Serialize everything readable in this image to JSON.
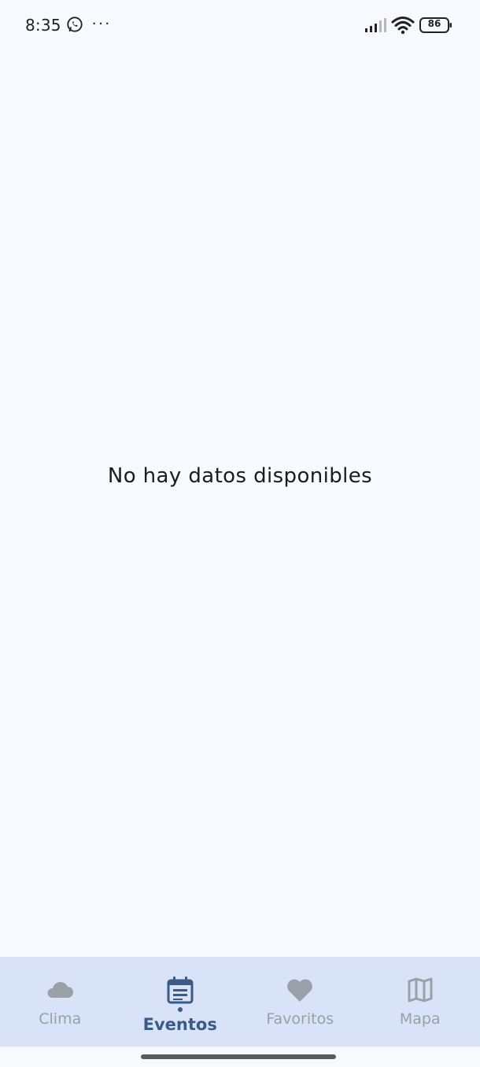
{
  "status_bar": {
    "time": "8:35",
    "more": "···",
    "battery": "86",
    "icons": [
      "whatsapp-icon",
      "signal-icon",
      "wifi-icon",
      "battery-icon"
    ]
  },
  "main": {
    "empty_message": "No hay datos disponibles"
  },
  "bottom_nav": {
    "active_index": 1,
    "items": [
      {
        "label": "Clima",
        "icon": "cloud-icon"
      },
      {
        "label": "Eventos",
        "icon": "calendar-icon"
      },
      {
        "label": "Favoritos",
        "icon": "heart-icon"
      },
      {
        "label": "Mapa",
        "icon": "map-icon"
      }
    ]
  },
  "colors": {
    "background": "#f7f9fe",
    "nav_background": "#d9e3f8",
    "active": "#3a5a88",
    "inactive": "#9aa0a8"
  }
}
